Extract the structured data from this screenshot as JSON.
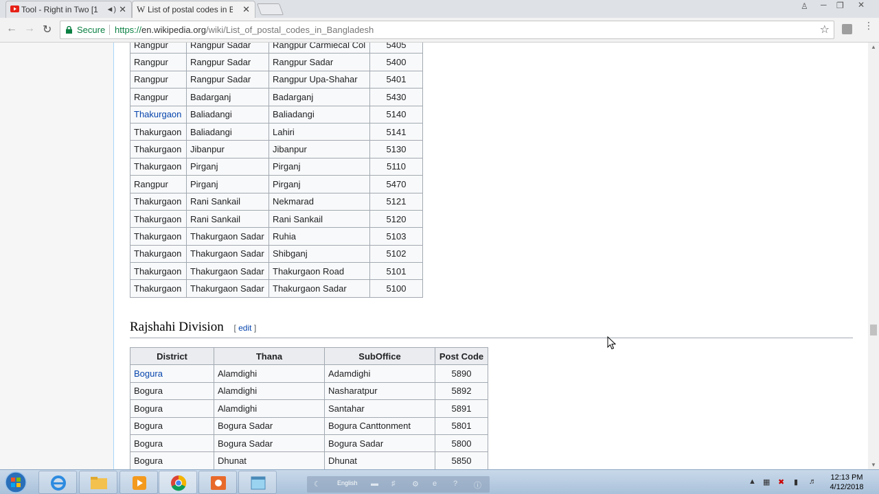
{
  "browser": {
    "tabs": [
      {
        "title": "Tool - Right in Two [1",
        "favicon": "youtube-icon",
        "state": "inactive"
      },
      {
        "title": "List of postal codes in Ba",
        "favicon": "wikipedia-icon",
        "state": "active"
      }
    ],
    "secure_label": "Secure",
    "url_scheme": "https://",
    "url_host": "en.wikipedia.org",
    "url_path": "/wiki/List_of_postal_codes_in_Bangladesh"
  },
  "rangpur_table": {
    "rows": [
      [
        "Rangpur",
        "Rangpur Sadar",
        "Rangpur Carmiecal Col",
        "5405"
      ],
      [
        "Rangpur",
        "Rangpur Sadar",
        "Rangpur Sadar",
        "5400"
      ],
      [
        "Rangpur",
        "Rangpur Sadar",
        "Rangpur Upa-Shahar",
        "5401"
      ],
      [
        "Rangpur",
        "Badarganj",
        "Badarganj",
        "5430"
      ],
      [
        "Thakurgaon",
        "Baliadangi",
        "Baliadangi",
        "5140"
      ],
      [
        "Thakurgaon",
        "Baliadangi",
        "Lahiri",
        "5141"
      ],
      [
        "Thakurgaon",
        "Jibanpur",
        "Jibanpur",
        "5130"
      ],
      [
        "Thakurgaon",
        "Pirganj",
        "Pirganj",
        "5110"
      ],
      [
        "Rangpur",
        "Pirganj",
        "Pirganj",
        "5470"
      ],
      [
        "Thakurgaon",
        "Rani Sankail",
        "Nekmarad",
        "5121"
      ],
      [
        "Thakurgaon",
        "Rani Sankail",
        "Rani Sankail",
        "5120"
      ],
      [
        "Thakurgaon",
        "Thakurgaon Sadar",
        "Ruhia",
        "5103"
      ],
      [
        "Thakurgaon",
        "Thakurgaon Sadar",
        "Shibganj",
        "5102"
      ],
      [
        "Thakurgaon",
        "Thakurgaon Sadar",
        "Thakurgaon Road",
        "5101"
      ],
      [
        "Thakurgaon",
        "Thakurgaon Sadar",
        "Thakurgaon Sadar",
        "5100"
      ]
    ]
  },
  "rajshahi_section": {
    "heading": "Rajshahi Division",
    "edit_open": "[ ",
    "edit_label": "edit",
    "edit_close": " ]",
    "columns": [
      "District",
      "Thana",
      "SubOffice",
      "Post Code"
    ],
    "rows": [
      [
        "Bogura",
        "Alamdighi",
        "Adamdighi",
        "5890"
      ],
      [
        "Bogura",
        "Alamdighi",
        "Nasharatpur",
        "5892"
      ],
      [
        "Bogura",
        "Alamdighi",
        "Santahar",
        "5891"
      ],
      [
        "Bogura",
        "Bogura Sadar",
        "Bogura Canttonment",
        "5801"
      ],
      [
        "Bogura",
        "Bogura Sadar",
        "Bogura Sadar",
        "5800"
      ],
      [
        "Bogura",
        "Dhunat",
        "Dhunat",
        "5850"
      ]
    ]
  },
  "taskbar": {
    "language": "English",
    "time": "12:13 PM",
    "date": "4/12/2018"
  },
  "colors": {
    "link": "#0645ad",
    "table_border": "#a2a9b1",
    "header_bg": "#eaecf0",
    "secure_green": "#0b8043"
  }
}
